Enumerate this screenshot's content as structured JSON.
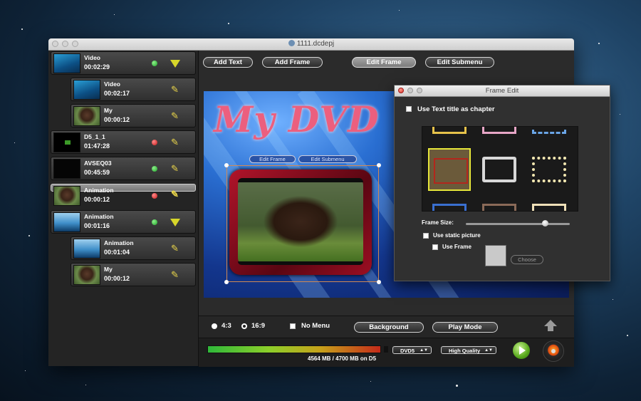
{
  "window": {
    "title": "1111.dcdepj"
  },
  "sidebar": {
    "items": [
      {
        "name": "Video",
        "time": "00:02:29",
        "thumb": "sea",
        "status": "green",
        "action": "expand"
      },
      {
        "name": "Video",
        "time": "00:02:17",
        "thumb": "sea",
        "status": "none",
        "action": "edit"
      },
      {
        "name": "My",
        "time": "00:00:12",
        "thumb": "dog",
        "status": "none",
        "action": "edit"
      },
      {
        "name": "D5_1_1",
        "time": "01:47:28",
        "thumb": "green",
        "status": "red",
        "action": "edit"
      },
      {
        "name": "AVSEQ03",
        "time": "00:45:59",
        "thumb": "dark",
        "status": "green",
        "action": "edit"
      },
      {
        "name": "Animation",
        "time": "00:00:12",
        "thumb": "dog",
        "status": "red",
        "action": "edit"
      },
      {
        "name": "Animation",
        "time": "00:01:16",
        "thumb": "anim",
        "status": "green",
        "action": "expand"
      },
      {
        "name": "Animation",
        "time": "00:01:04",
        "thumb": "anim",
        "status": "none",
        "action": "edit"
      },
      {
        "name": "My",
        "time": "00:00:12",
        "thumb": "dog",
        "status": "none",
        "action": "edit"
      }
    ]
  },
  "toolbar": {
    "add_text": "Add Text",
    "add_frame": "Add Frame",
    "edit_frame": "Edit Frame",
    "edit_submenu": "Edit Submenu"
  },
  "canvas": {
    "title_text": "My DVD",
    "pill_edit_frame": "Edit Frame",
    "pill_edit_submenu": "Edit Submenu"
  },
  "bottom": {
    "ratio_43": "4:3",
    "ratio_169": "16:9",
    "no_menu": "No Menu",
    "background": "Background",
    "play_mode": "Play Mode"
  },
  "status": {
    "storage_text": "4564 MB / 4700 MB on D5",
    "disc_type": "DVD5",
    "quality": "High Quality",
    "usage_fraction": 0.971
  },
  "dialog": {
    "title": "Frame Edit",
    "use_text_title": "Use Text title as chapter",
    "frame_size_label": "Frame Size:",
    "frame_size_fraction": 0.73,
    "use_static_picture": "Use static picture",
    "use_frame": "Use Frame",
    "choose": "Choose"
  },
  "colors": {
    "accent_active_button": "#8f8f8f",
    "status_green": "#1fa22a",
    "status_red": "#c41818",
    "title_pink": "#ec5f7e",
    "selection_yellow": "#e6e63a"
  }
}
